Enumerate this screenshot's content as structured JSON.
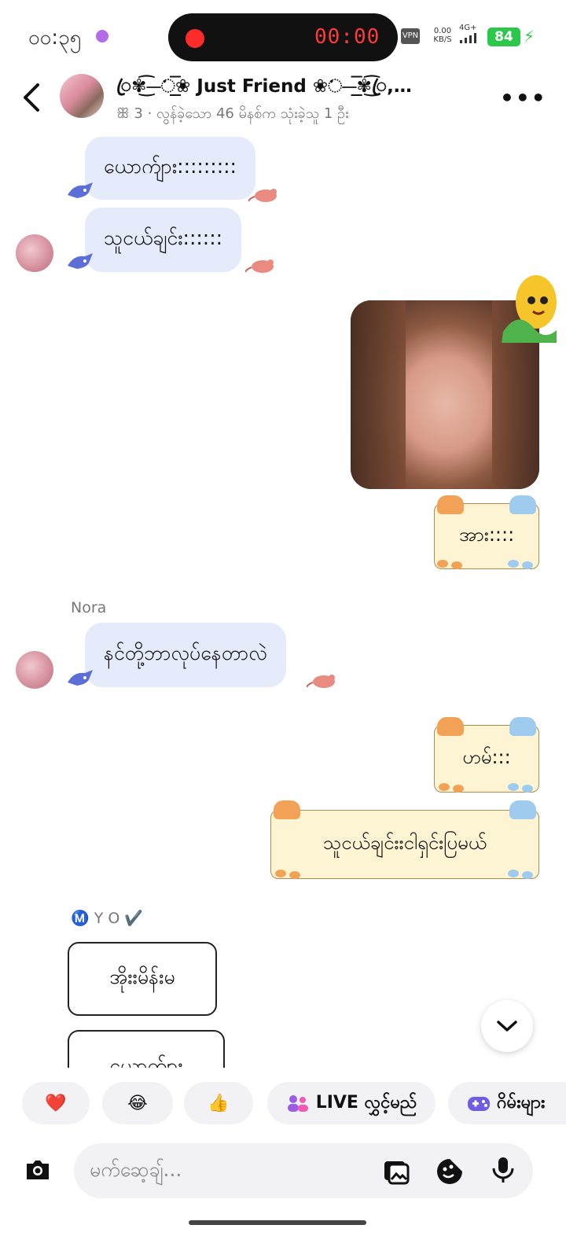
{
  "status_bar": {
    "time": "၀၀:၃၅",
    "record_timer": "00:00",
    "vpn": "VPN",
    "net_speed_value": "0.00",
    "net_speed_unit": "KB/S",
    "network": "4G+",
    "battery": "84"
  },
  "header": {
    "title": "ꦿ✾͜͡⏤ᨗ͟͟͞͞❀ Just Friend ❀ᨗ⏤͟͟͞͞✾͜͡ꦿ,…",
    "subtitle": "ꕥ 3 · လွန်ခဲ့သော 46 မိနစ်က သုံးခဲ့သူ 1 ဦး"
  },
  "messages": {
    "m1": "ယောက်ျား:::::::::",
    "m2": "သူငယ်ချင်း::::::",
    "m3": "အား::::",
    "sender_nora": "Nora",
    "m4": "နင်တို့ဘာလုပ်နေတာလဲ",
    "m5": "ဟမ်:::",
    "m6": "သူငယ်ချင်းးငါရှင်းပြမယ်",
    "sender_myo": "Ⓜ️ Y O ✔️",
    "m7": "အိုးးမိန်းမ",
    "m8": "ယောက်ျား"
  },
  "quick_actions": {
    "heart": "❤️",
    "laugh": "😂",
    "like": "👍",
    "live_label": "LIVE လွှင့်မည်",
    "games_label": "ဂိမ်းများ"
  },
  "composer": {
    "placeholder": "မက်ဆေ့ချ်..."
  },
  "colors": {
    "incoming_bubble": "#e6ebfb",
    "note_card": "#fdf4d4",
    "record_red": "#ff3a3a",
    "battery_green": "#2bc84a"
  }
}
